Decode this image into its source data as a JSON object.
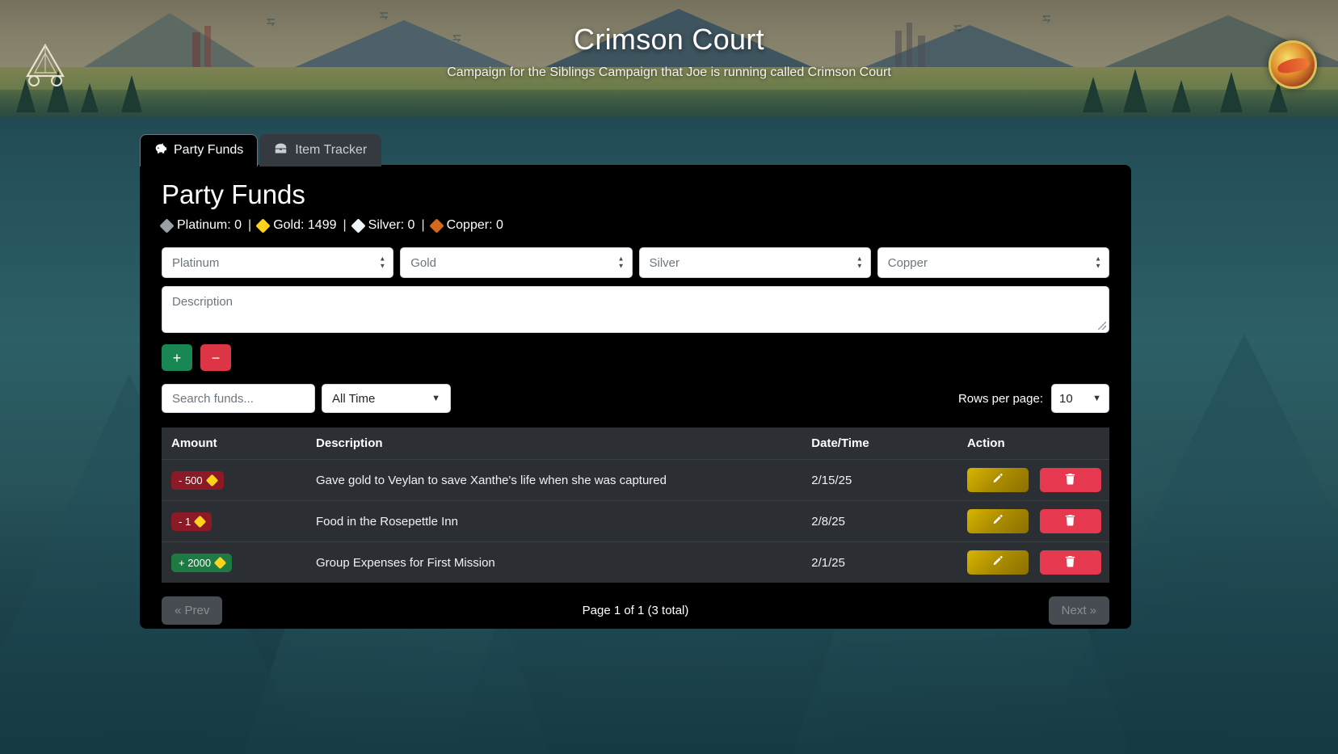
{
  "banner": {
    "title": "Crimson Court",
    "subtitle": "Campaign for the Siblings Campaign that Joe is running called Crimson Court",
    "left_logo_name": "dnd-dice-logo",
    "right_logo_name": "dragon-emblem-logo"
  },
  "tabs": [
    {
      "label": "Party Funds",
      "icon": "piggy-bank-icon",
      "active": true
    },
    {
      "label": "Item Tracker",
      "icon": "treasure-chest-icon",
      "active": false
    }
  ],
  "page": {
    "title": "Party Funds"
  },
  "currency": [
    {
      "name": "Platinum",
      "label": "Platinum: 0",
      "value": 0,
      "color": "#9aa0a6"
    },
    {
      "name": "Gold",
      "label": "Gold: 1499",
      "value": 1499,
      "color": "#ffd31a"
    },
    {
      "name": "Silver",
      "label": "Silver: 0",
      "value": 0,
      "color": "#f2f5f7"
    },
    {
      "name": "Copper",
      "label": "Copper: 0",
      "value": 0,
      "color": "#d2691e"
    }
  ],
  "currency_separator": "|",
  "amount_inputs": [
    {
      "name": "platinum",
      "placeholder": "Platinum",
      "value": ""
    },
    {
      "name": "gold",
      "placeholder": "Gold",
      "value": ""
    },
    {
      "name": "silver",
      "placeholder": "Silver",
      "value": ""
    },
    {
      "name": "copper",
      "placeholder": "Copper",
      "value": ""
    }
  ],
  "description_input": {
    "placeholder": "Description",
    "value": ""
  },
  "action_buttons": {
    "add_label": "+",
    "subtract_label": "−"
  },
  "filters": {
    "search_placeholder": "Search funds...",
    "search_value": "",
    "time_filter_selected": "All Time",
    "rows_per_page_label": "Rows per page:",
    "rows_per_page_selected": "10"
  },
  "table": {
    "columns": [
      "Amount",
      "Description",
      "Date/Time",
      "Action"
    ],
    "rows": [
      {
        "amount_text": "- 500",
        "amount_sign": "negative",
        "coin": "gold",
        "description": "Gave gold to Veylan to save Xanthe's life when she was captured",
        "date": "2/15/25",
        "edit_icon": "pencil-icon",
        "delete_icon": "trash-icon"
      },
      {
        "amount_text": "- 1",
        "amount_sign": "negative",
        "coin": "gold",
        "description": "Food in the Rosepettle Inn",
        "date": "2/8/25",
        "edit_icon": "pencil-icon",
        "delete_icon": "trash-icon"
      },
      {
        "amount_text": "+ 2000",
        "amount_sign": "positive",
        "coin": "gold",
        "description": "Group Expenses for First Mission",
        "date": "2/1/25",
        "edit_icon": "pencil-icon",
        "delete_icon": "trash-icon"
      }
    ]
  },
  "pagination": {
    "prev_label": "« Prev",
    "next_label": "Next »",
    "info": "Page 1 of 1 (3 total)"
  },
  "colors": {
    "positive": "#1d7a43",
    "negative": "#8b1a26",
    "edit": "#ab8c00",
    "delete": "#e63950",
    "add": "#198754",
    "subtract": "#dc3545"
  }
}
